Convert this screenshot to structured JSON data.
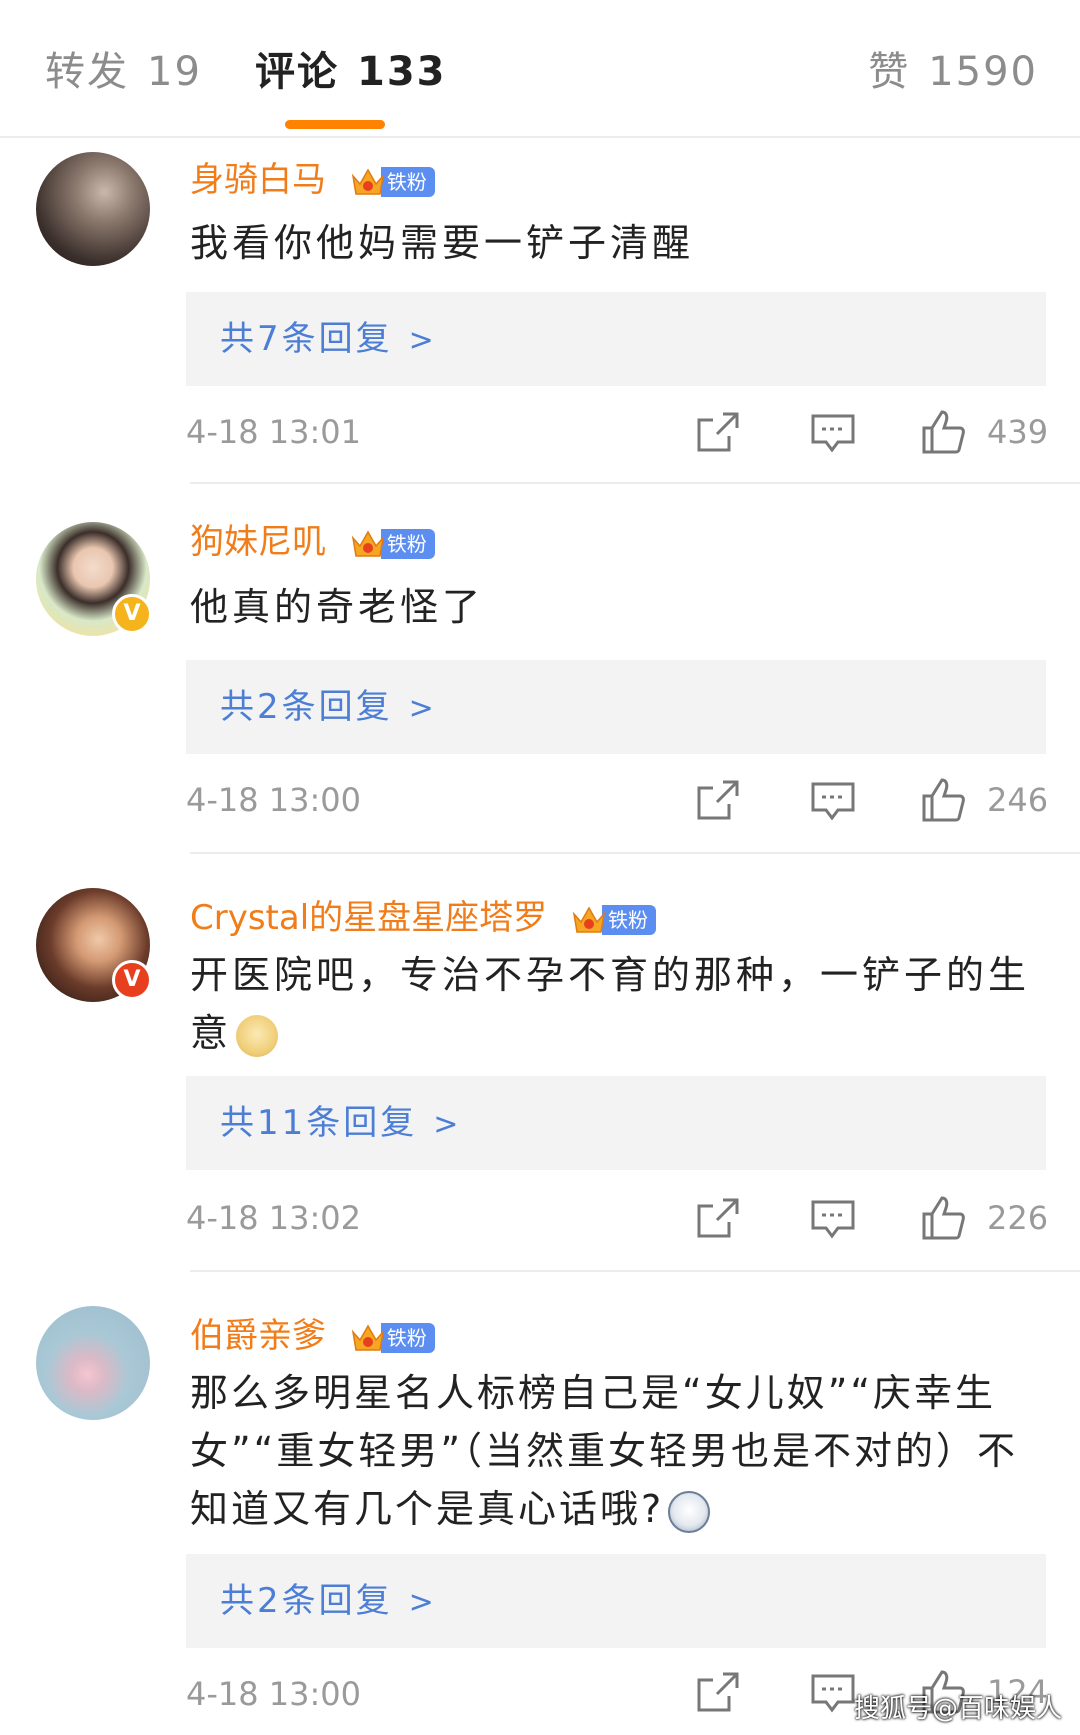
{
  "tabs": {
    "repost_label": "转发",
    "repost_count": "19",
    "comment_label": "评论",
    "comment_count": "133",
    "like_label": "赞",
    "like_count": "1590"
  },
  "fan_badge": "铁粉",
  "comments": [
    {
      "user": "身骑白马",
      "text": "我看你他妈需要一铲子清醒",
      "replies": "共7条回复",
      "time": "4-18 13:01",
      "likes": "439"
    },
    {
      "user": "狗妹尼叽",
      "text": "他真的奇老怪了",
      "replies": "共2条回复",
      "time": "4-18 13:00",
      "likes": "246"
    },
    {
      "user": "Crystal的星盘星座塔罗",
      "text": "开医院吧，专治不孕不育的那种，一铲子的生意",
      "replies": "共11条回复",
      "time": "4-18 13:02",
      "likes": "226"
    },
    {
      "user": "伯爵亲爹",
      "text": "那么多明星名人标榜自己是“女儿奴”“庆幸生女”“重女轻男”（当然重女轻男也是不对的）不知道又有几个是真心话哦?",
      "replies": "共2条回复",
      "time": "4-18 13:00",
      "likes": "124"
    }
  ],
  "watermark": "搜狐号@百味娱人",
  "colors": {
    "accent": "#ff8200",
    "username": "#f07d1a",
    "reply_link": "#4c7ed6",
    "fan_badge": "#5b8ef0"
  },
  "icons": [
    "share-icon",
    "comment-icon",
    "thumbs-up-icon",
    "chevron-right-icon",
    "crown-icon",
    "verified-badge-icon"
  ]
}
